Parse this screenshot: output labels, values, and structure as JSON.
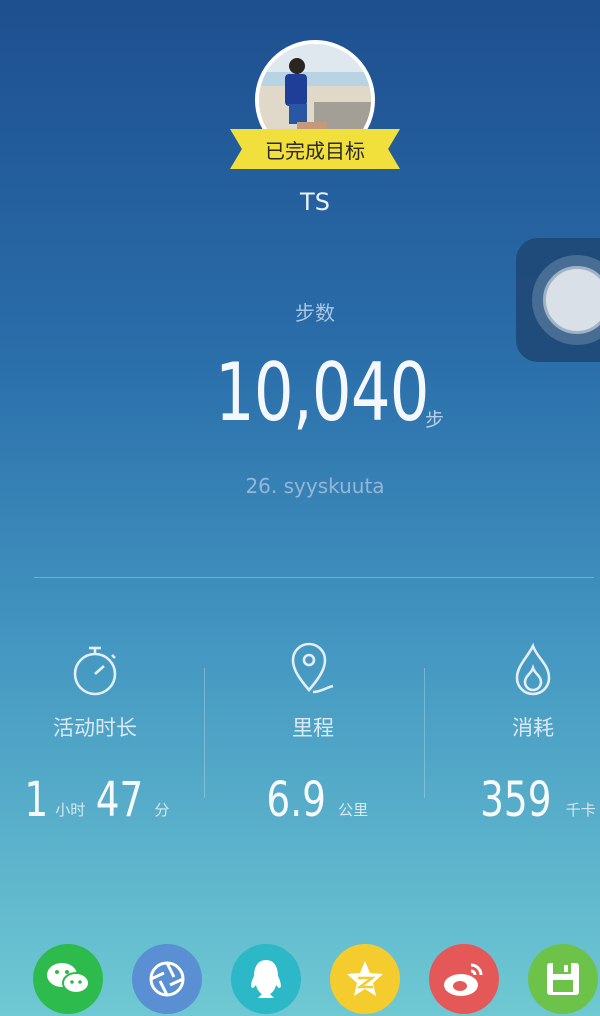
{
  "profile": {
    "badge": "已完成目标",
    "username": "TS"
  },
  "steps": {
    "label": "步数",
    "value": "10,040",
    "unit": "步",
    "date": "26. syyskuuta"
  },
  "stats": [
    {
      "icon": "stopwatch-icon",
      "label": "活动时长",
      "h": "1",
      "h_unit": "小时",
      "m": "47",
      "m_unit": "分"
    },
    {
      "icon": "location-pin-icon",
      "label": "里程",
      "value": "6.9",
      "unit": "公里"
    },
    {
      "icon": "flame-icon",
      "label": "消耗",
      "value": "359",
      "unit": "千卡"
    }
  ],
  "share": [
    {
      "icon": "wechat-icon",
      "color": "#2dbb4d"
    },
    {
      "icon": "moments-icon",
      "color": "#5a8fd3"
    },
    {
      "icon": "qq-icon",
      "color": "#2cb8c6"
    },
    {
      "icon": "qzone-icon",
      "color": "#f4cc2e"
    },
    {
      "icon": "weibo-icon",
      "color": "#e55858"
    },
    {
      "icon": "save-icon",
      "color": "#6dc24a"
    }
  ],
  "colors": {
    "ribbon": "#f1df3b",
    "bg_top": "#1e4f8f",
    "bg_bottom": "#6fc9d3"
  }
}
